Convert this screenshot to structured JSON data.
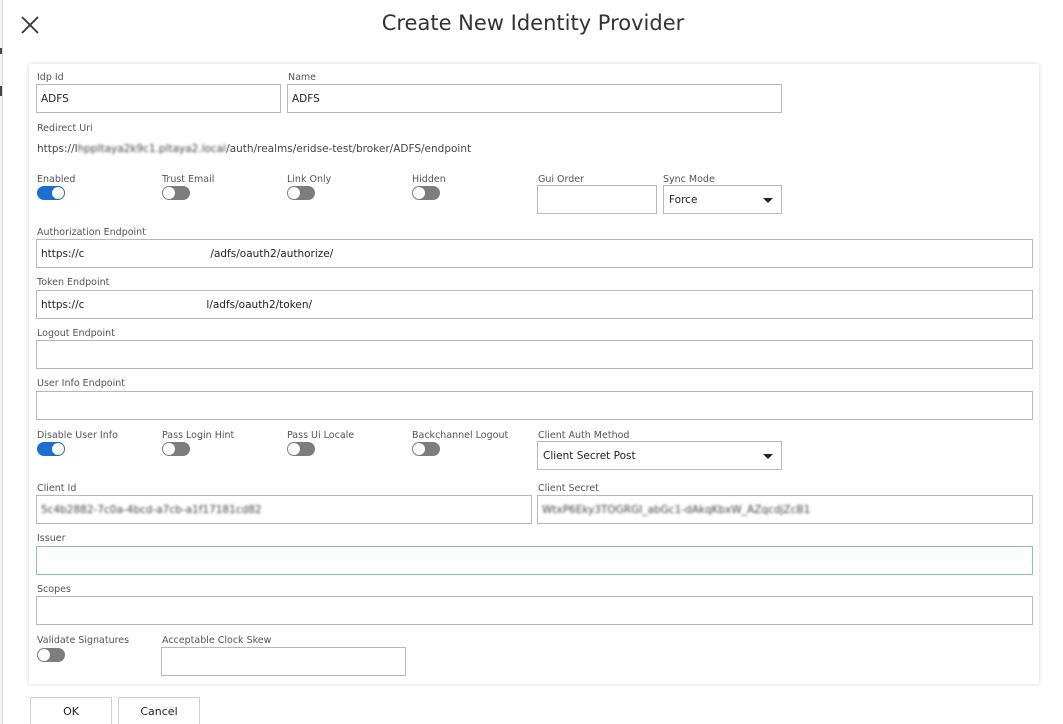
{
  "dialog": {
    "title": "Create New Identity Provider",
    "close_icon": "close-x-icon"
  },
  "form": {
    "idp_id": {
      "label": "Idp Id",
      "value": "ADFS"
    },
    "name": {
      "label": "Name",
      "value": "ADFS"
    },
    "redirect_uri": {
      "label": "Redirect Uri",
      "prefix": "https://l",
      "hidden_part": "hppltaya2k9c1.pltaya2.local",
      "suffix": "/auth/realms/eridse-test/broker/ADFS/endpoint"
    },
    "enabled": {
      "label": "Enabled",
      "on": true
    },
    "trust_email": {
      "label": "Trust Email",
      "on": false
    },
    "link_only": {
      "label": "Link Only",
      "on": false
    },
    "hidden": {
      "label": "Hidden",
      "on": false
    },
    "gui_order": {
      "label": "Gui Order",
      "value": ""
    },
    "sync_mode": {
      "label": "Sync Mode",
      "value": "Force"
    },
    "authorization_endpoint": {
      "label": "Authorization Endpoint",
      "prefix": "https://c",
      "suffix": "/adfs/oauth2/authorize/"
    },
    "token_endpoint": {
      "label": "Token Endpoint",
      "prefix": "https://c",
      "suffix": "l/adfs/oauth2/token/"
    },
    "logout_endpoint": {
      "label": "Logout Endpoint",
      "value": ""
    },
    "user_info_endpoint": {
      "label": "User Info Endpoint",
      "value": ""
    },
    "disable_user_info": {
      "label": "Disable User Info",
      "on": true
    },
    "pass_login_hint": {
      "label": "Pass Login Hint",
      "on": false
    },
    "pass_ui_locale": {
      "label": "Pass Ui Locale",
      "on": false
    },
    "backchannel_logout": {
      "label": "Backchannel Logout",
      "on": false
    },
    "client_auth_method": {
      "label": "Client Auth Method",
      "value": "Client Secret Post"
    },
    "client_id": {
      "label": "Client Id",
      "value": "5c4b2882-7c0a-4bcd-a7cb-a1f17181cd82"
    },
    "client_secret": {
      "label": "Client Secret",
      "value": "WtxP6Eky3TOGRGI_abGc1-dAkqKbxW_AZqcdjZcB1"
    },
    "issuer": {
      "label": "Issuer",
      "value": ""
    },
    "scopes": {
      "label": "Scopes",
      "value": ""
    },
    "validate_signatures": {
      "label": "Validate Signatures",
      "on": false
    },
    "acceptable_clock_skew": {
      "label": "Acceptable Clock Skew",
      "value": ""
    }
  },
  "buttons": {
    "ok": "OK",
    "cancel": "Cancel"
  },
  "colors": {
    "toggle_on": "#1a6fd1",
    "toggle_off": "#7d7d7d",
    "focus_border": "#7fcf9a"
  }
}
